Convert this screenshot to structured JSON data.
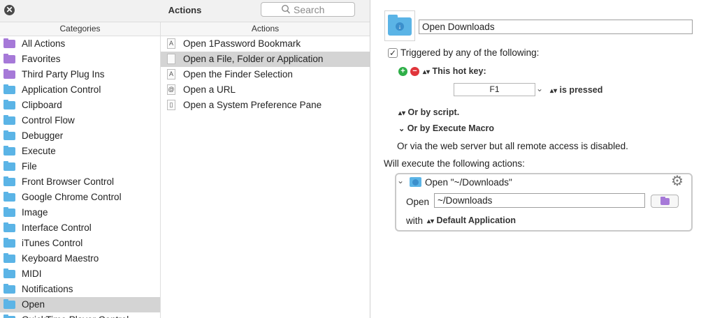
{
  "window": {
    "title": "Actions",
    "close_glyph": "✕"
  },
  "search": {
    "placeholder": "Search",
    "icon": "search-icon"
  },
  "columns": {
    "categories": "Categories",
    "actions": "Actions"
  },
  "categories": [
    {
      "label": "All Actions",
      "color": "#a679d8"
    },
    {
      "label": "Favorites",
      "color": "#a679d8"
    },
    {
      "label": "Third Party Plug Ins",
      "color": "#a679d8"
    },
    {
      "label": "Application Control",
      "color": "#5bb4e6"
    },
    {
      "label": "Clipboard",
      "color": "#5bb4e6"
    },
    {
      "label": "Control Flow",
      "color": "#5bb4e6"
    },
    {
      "label": "Debugger",
      "color": "#5bb4e6"
    },
    {
      "label": "Execute",
      "color": "#5bb4e6"
    },
    {
      "label": "File",
      "color": "#5bb4e6"
    },
    {
      "label": "Front Browser Control",
      "color": "#5bb4e6"
    },
    {
      "label": "Google Chrome Control",
      "color": "#5bb4e6"
    },
    {
      "label": "Image",
      "color": "#5bb4e6"
    },
    {
      "label": "Interface Control",
      "color": "#5bb4e6"
    },
    {
      "label": "iTunes Control",
      "color": "#5bb4e6"
    },
    {
      "label": "Keyboard Maestro",
      "color": "#5bb4e6"
    },
    {
      "label": "MIDI",
      "color": "#5bb4e6"
    },
    {
      "label": "Notifications",
      "color": "#5bb4e6"
    },
    {
      "label": "Open",
      "color": "#5bb4e6",
      "selected": true
    },
    {
      "label": "QuickTime Player Control",
      "color": "#5bb4e6"
    }
  ],
  "actions": [
    {
      "label": "Open 1Password Bookmark",
      "glyph": "A"
    },
    {
      "label": "Open a File, Folder or Application",
      "glyph": "",
      "selected": true
    },
    {
      "label": "Open the Finder Selection",
      "glyph": "A"
    },
    {
      "label": "Open a URL",
      "glyph": "@"
    },
    {
      "label": "Open a System Preference Pane",
      "glyph": "▯"
    }
  ],
  "macro": {
    "name": "Open Downloads",
    "triggered_label": "Triggered by any of the following:",
    "add_glyph": "+",
    "remove_glyph": "−",
    "updown_glyph": "⌃",
    "hot_key_label": "This hot key:",
    "hot_key": "F1",
    "hot_key_menu_glyph": "⌄",
    "is_pressed": "is pressed",
    "or_script": "Or by script.",
    "or_execute": "Or by Execute Macro",
    "web_server_note": "Or via the web server but all remote access is disabled.",
    "will_execute": "Will execute the following actions:"
  },
  "action_block": {
    "collapse_glyph": "⌄",
    "title": "Open \"~/Downloads\"",
    "open_label": "Open",
    "path": "~/Downloads",
    "with_label": "with",
    "app": "Default Application",
    "gear_glyph": "⚙"
  },
  "colors": {
    "folder_blue": "#5bb4e6",
    "folder_purple": "#a679d8",
    "add_green": "#2eaf48",
    "remove_red": "#e0353b",
    "selection_gray": "#d4d4d4"
  }
}
